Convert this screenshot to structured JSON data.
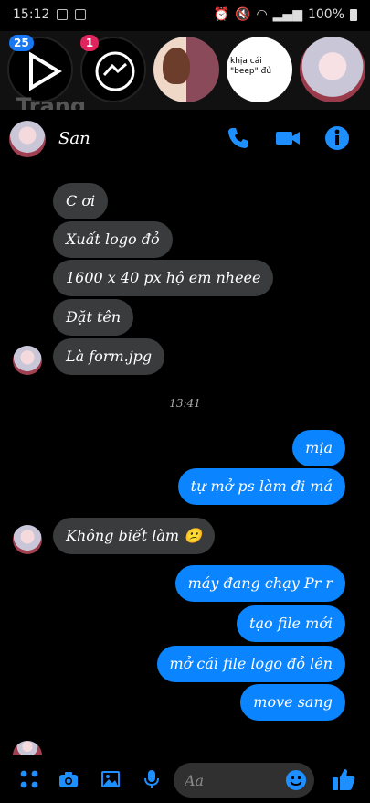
{
  "status_bar": {
    "time": "15:12",
    "battery": "100%"
  },
  "chat_heads": {
    "badge_1": "25",
    "badge_2": "1",
    "peek_name": "Trang",
    "card_text": "khịa cái \"beep\" đủ"
  },
  "header": {
    "contact_name": "San"
  },
  "timestamp": "13:41",
  "messages": [
    {
      "side": "in",
      "text": "C ơi"
    },
    {
      "side": "in",
      "text": "Xuất logo đỏ"
    },
    {
      "side": "in",
      "text": "1600 x 40 px hộ em nheee"
    },
    {
      "side": "in",
      "text": "Đặt tên"
    },
    {
      "side": "in",
      "text": "Là form.jpg"
    },
    {
      "side": "out",
      "text": "mịa"
    },
    {
      "side": "out",
      "text": "tự mở ps làm đi má"
    },
    {
      "side": "in",
      "text": "Không biết làm 😕"
    },
    {
      "side": "out",
      "text": "máy đang chạy Pr r"
    },
    {
      "side": "out",
      "text": "tạo file mới"
    },
    {
      "side": "out",
      "text": "mở cái file logo đỏ lên"
    },
    {
      "side": "out",
      "text": "move sang"
    }
  ],
  "composer": {
    "placeholder": "Aa"
  },
  "colors": {
    "accent": "#0a84ff",
    "incoming_bubble": "#3a3b3c",
    "background": "#000000"
  }
}
